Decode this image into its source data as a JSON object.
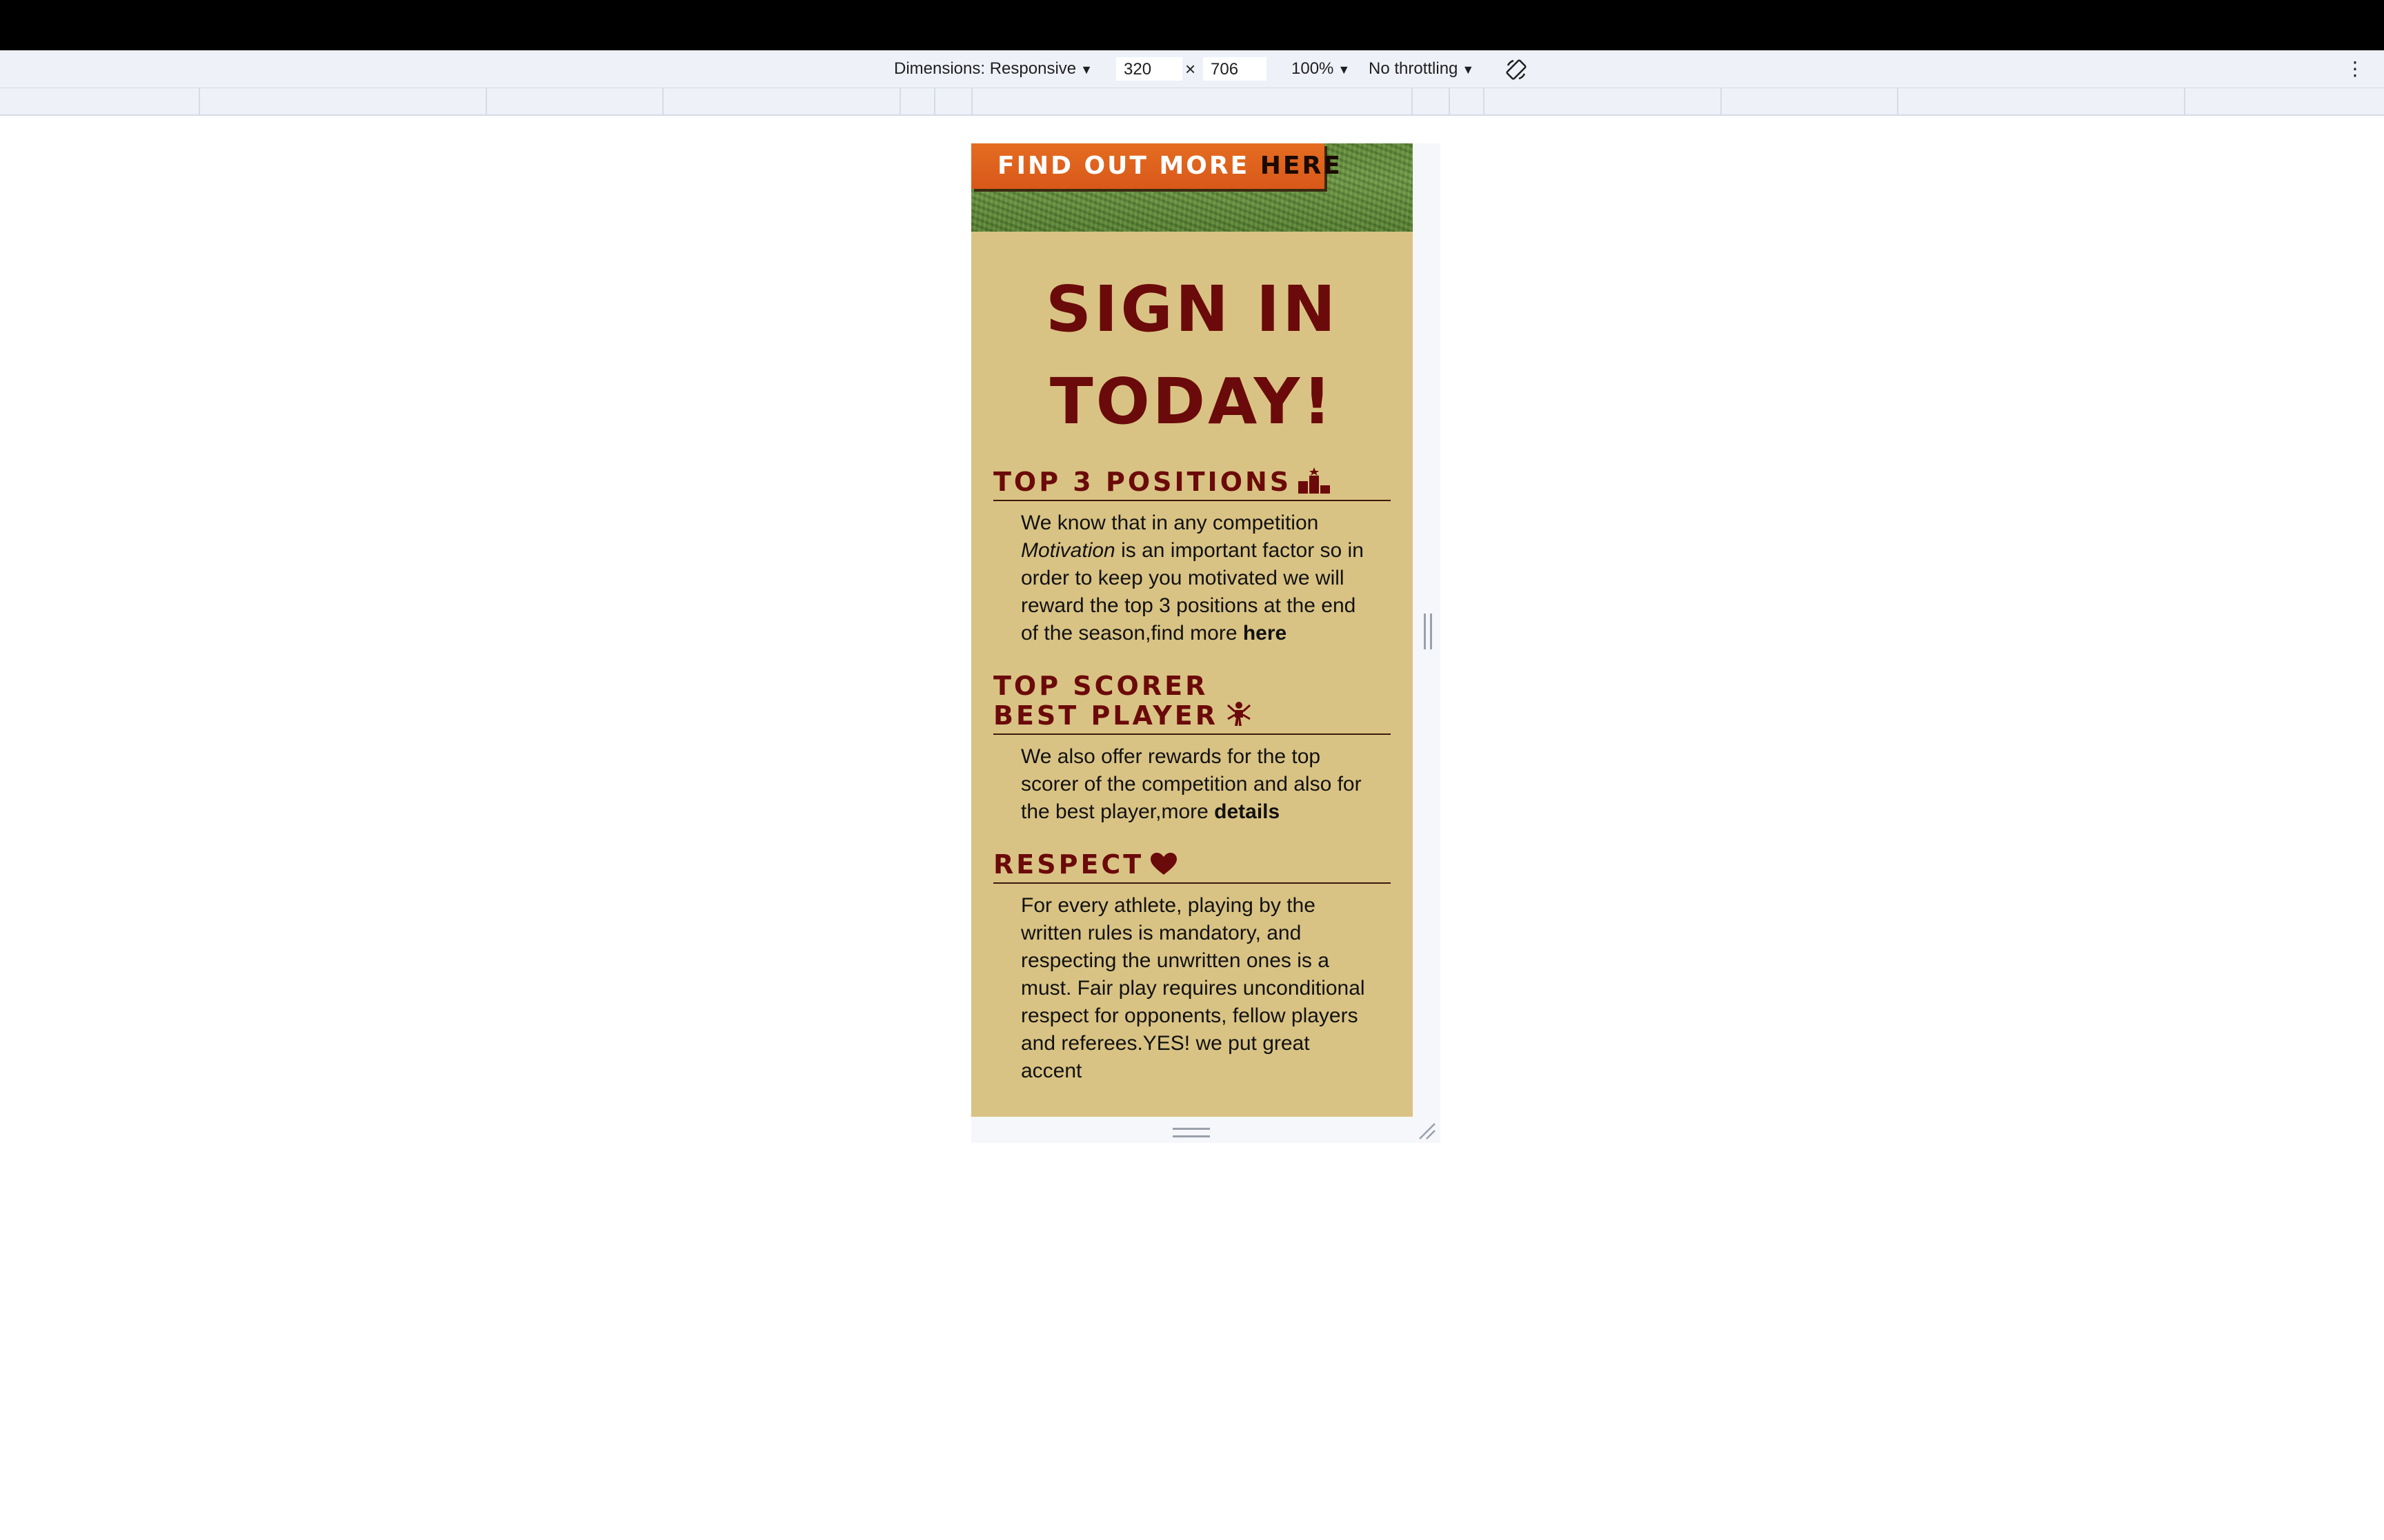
{
  "devtools": {
    "dimensions_label": "Dimensions: Responsive",
    "width_value": "320",
    "times": "×",
    "height_value": "706",
    "zoom": "100%",
    "throttling": "No throttling",
    "more_icon": "kebab-icon",
    "rotate_icon": "rotate-icon"
  },
  "page": {
    "banner": {
      "text": "FIND OUT MORE",
      "link": "HERE"
    },
    "title": "SIGN IN TODAY!",
    "sections": [
      {
        "heading": "TOP 3 POSITIONS",
        "icon": "podium-icon",
        "p1": "We know that in any competition ",
        "em": "Motivation",
        "p2": " is an important factor so in order to keep you motivated we will reward the top 3 positions at the end of the season,find more ",
        "link": "here"
      },
      {
        "heading_line1": "TOP SCORER",
        "heading_line2": "BEST PLAYER",
        "icon": "player-icon",
        "text": "We also offer rewards for the top scorer of the competition and also for the best player,more ",
        "link": "details"
      },
      {
        "heading": "RESPECT",
        "icon": "heart-icon",
        "text": "For every athlete, playing by the written rules is mandatory, and respecting the unwritten ones is a must. Fair play requires unconditional respect for opponents, fellow players and referees.YES! we put great accent"
      }
    ]
  },
  "colors": {
    "accent": "#6b0a0a",
    "background": "#d9c384",
    "banner": "#e46d21"
  }
}
